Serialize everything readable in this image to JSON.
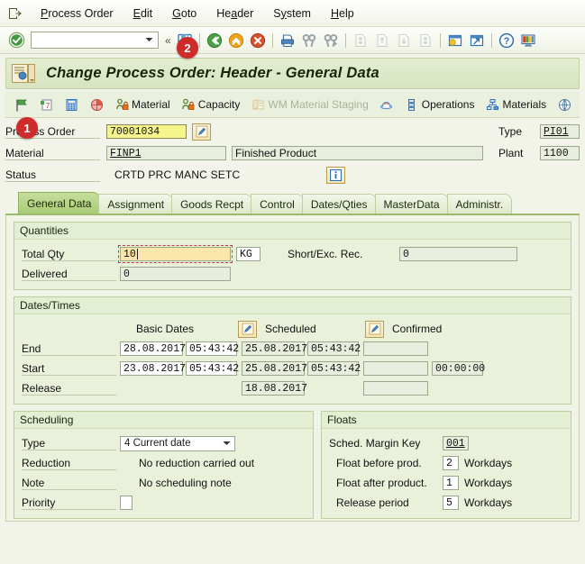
{
  "menubar": {
    "system_icon": "sap-system-menu-icon",
    "items": [
      {
        "label": "Process Order",
        "accel": "P"
      },
      {
        "label": "Edit",
        "accel": "E"
      },
      {
        "label": "Goto",
        "accel": "G"
      },
      {
        "label": "Header",
        "accel": "a"
      },
      {
        "label": "System",
        "accel": "y"
      },
      {
        "label": "Help",
        "accel": "H"
      }
    ]
  },
  "toolbar": {
    "enter_icon": "green-check-enter-icon",
    "command_field_value": "",
    "command_field_placeholder": "",
    "dropdown_icon": "chevron-down-icon",
    "collapse_icon": "double-left-chevron-icon",
    "buttons": [
      {
        "name": "save-icon",
        "label": "Save",
        "enabled": true
      },
      {
        "name": "back-icon",
        "label": "Back",
        "enabled": true
      },
      {
        "name": "exit-icon",
        "label": "Exit",
        "enabled": true
      },
      {
        "name": "cancel-icon",
        "label": "Cancel",
        "enabled": true
      },
      {
        "name": "print-icon",
        "label": "Print",
        "enabled": true
      },
      {
        "name": "find-icon",
        "label": "Find",
        "enabled": true
      },
      {
        "name": "find-next-icon",
        "label": "Find Next",
        "enabled": true
      },
      {
        "name": "first-page-icon",
        "label": "First Page",
        "enabled": false
      },
      {
        "name": "previous-page-icon",
        "label": "Previous Page",
        "enabled": false
      },
      {
        "name": "next-page-icon",
        "label": "Next Page",
        "enabled": false
      },
      {
        "name": "last-page-icon",
        "label": "Last Page",
        "enabled": false
      },
      {
        "name": "create-session-icon",
        "label": "Create New Session",
        "enabled": true
      },
      {
        "name": "create-shortcut-icon",
        "label": "Create Shortcut",
        "enabled": true
      },
      {
        "name": "help-icon",
        "label": "Help",
        "enabled": true
      },
      {
        "name": "customize-layout-icon",
        "label": "Customize Local Layout",
        "enabled": true
      }
    ]
  },
  "title": {
    "icon": "transaction-title-icon",
    "text": "Change Process Order: Header - General Data"
  },
  "app_toolbar": {
    "items": [
      {
        "name": "flag-icon",
        "label": "",
        "icon": "green-flag-icon",
        "enabled": true
      },
      {
        "name": "order-info-icon",
        "label": "",
        "icon": "document-7-icon",
        "enabled": true
      },
      {
        "name": "calculator-icon",
        "label": "",
        "icon": "calculator-icon",
        "enabled": true
      },
      {
        "name": "pie-chart-icon",
        "label": "",
        "icon": "pie-chart-icon",
        "enabled": true
      },
      {
        "name": "material-button",
        "label": "Material",
        "icon": "material-availability-icon",
        "enabled": true
      },
      {
        "name": "capacity-button",
        "label": "Capacity",
        "icon": "capacity-availability-icon",
        "enabled": true
      },
      {
        "name": "wm-material-staging-button",
        "label": "WM Material Staging",
        "icon": "wm-staging-icon",
        "enabled": false
      },
      {
        "name": "batch-icon",
        "label": "",
        "icon": "batch-icon",
        "enabled": true
      },
      {
        "name": "operations-button",
        "label": "Operations",
        "icon": "operations-icon",
        "enabled": true
      },
      {
        "name": "materials-button",
        "label": "Materials",
        "icon": "materials-tree-icon",
        "enabled": true
      },
      {
        "name": "prt-icon",
        "label": "",
        "icon": "globe-icon",
        "enabled": true
      }
    ]
  },
  "header": {
    "process_order": {
      "label": "Process Order",
      "value": "70001034",
      "edit_button_icon": "pencil-edit-icon"
    },
    "type": {
      "label": "Type",
      "value": "PI01"
    },
    "material": {
      "label": "Material",
      "value": "FINP1",
      "description": "Finished Product"
    },
    "plant": {
      "label": "Plant",
      "value": "1100"
    },
    "status": {
      "label": "Status",
      "value": "CRTD PRC  MANC SETC",
      "info_button_icon": "information-icon"
    }
  },
  "markers": [
    {
      "id": "1",
      "number": "1"
    },
    {
      "id": "2",
      "number": "2"
    }
  ],
  "tabs": [
    {
      "label": "General Data",
      "selected": true
    },
    {
      "label": "Assignment",
      "selected": false
    },
    {
      "label": "Goods Recpt",
      "selected": false
    },
    {
      "label": "Control",
      "selected": false
    },
    {
      "label": "Dates/Qties",
      "selected": false
    },
    {
      "label": "MasterData",
      "selected": false
    },
    {
      "label": "Administr.",
      "selected": false
    }
  ],
  "quantities": {
    "title": "Quantities",
    "total_qty": {
      "label": "Total Qty",
      "value": "10",
      "unit": "KG",
      "focused": true
    },
    "delivered": {
      "label": "Delivered",
      "value": "0"
    },
    "short_exc_rec": {
      "label": "Short/Exc. Rec.",
      "value": "0"
    }
  },
  "dates_times": {
    "title": "Dates/Times",
    "columns": {
      "basic_dates": "Basic Dates",
      "scheduled": "Scheduled",
      "confirmed": "Confirmed",
      "basic_dates_button_icon": "pencil-edit-icon",
      "scheduled_button_icon": "pencil-edit-icon"
    },
    "rows": [
      {
        "label": "End",
        "basic_date": "28.08.2017",
        "basic_time": "05:43:42",
        "sched_date": "25.08.2017",
        "sched_time": "05:43:42",
        "conf_date": "",
        "conf_time": ""
      },
      {
        "label": "Start",
        "basic_date": "23.08.2017",
        "basic_time": "05:43:42",
        "sched_date": "25.08.2017",
        "sched_time": "05:43:42",
        "conf_date": "",
        "conf_time": "00:00:00"
      },
      {
        "label": "Release",
        "basic_date": "",
        "basic_time": "",
        "sched_date": "18.08.2017",
        "sched_time": "",
        "conf_date": "",
        "conf_time": ""
      }
    ]
  },
  "scheduling": {
    "title": "Scheduling",
    "type": {
      "label": "Type",
      "value": "4 Current date",
      "dropdown_icon": "chevron-down-icon"
    },
    "reduction": {
      "label": "Reduction",
      "value": "No reduction carried out"
    },
    "note": {
      "label": "Note",
      "value": "No scheduling note"
    },
    "priority": {
      "label": "Priority",
      "value": ""
    }
  },
  "floats": {
    "title": "Floats",
    "sched_margin_key": {
      "label": "Sched. Margin Key",
      "value": "001"
    },
    "float_before_prod": {
      "label": "Float before prod.",
      "value": "2",
      "unit": "Workdays"
    },
    "float_after_product": {
      "label": "Float after product.",
      "value": "1",
      "unit": "Workdays"
    },
    "release_period": {
      "label": "Release period",
      "value": "5",
      "unit": "Workdays"
    }
  },
  "colors": {
    "marker_red": "#cf2b2b",
    "focus_yellow": "#f5f58c",
    "tab_selected": "#a9cc76",
    "panel_green": "#e9f1da"
  }
}
